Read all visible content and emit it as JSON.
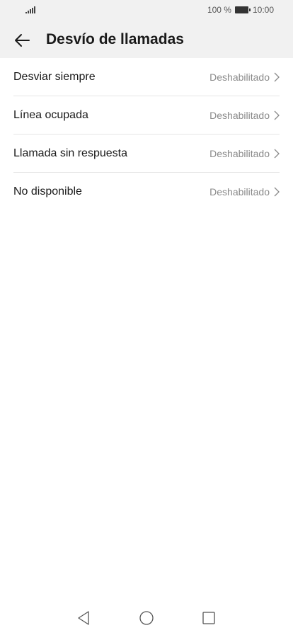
{
  "status_bar": {
    "battery_text": "100 %",
    "time": "10:00"
  },
  "header": {
    "title": "Desvío de llamadas",
    "back_icon": "arrow-left-icon"
  },
  "settings": [
    {
      "label": "Desviar siempre",
      "value": "Deshabilitado"
    },
    {
      "label": "Línea ocupada",
      "value": "Deshabilitado"
    },
    {
      "label": "Llamada sin respuesta",
      "value": "Deshabilitado"
    },
    {
      "label": "No disponible",
      "value": "Deshabilitado"
    }
  ],
  "nav_bar": {
    "icons": [
      "triangle-back-icon",
      "circle-home-icon",
      "square-recent-icon"
    ]
  },
  "colors": {
    "header_bg": "#f1f1f1",
    "text_primary": "#1a1a1a",
    "text_secondary": "#8a8a8a",
    "divider": "#e6e6e6"
  }
}
